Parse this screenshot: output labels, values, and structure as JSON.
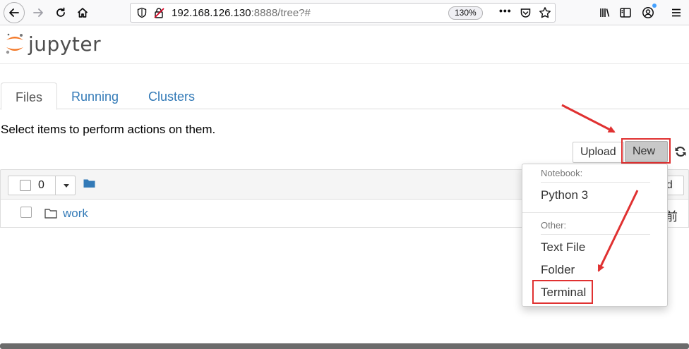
{
  "browser": {
    "url_host": "192.168.126.130",
    "url_rest": ":8888/tree?#",
    "zoom": "130%",
    "overflow_menu_label": "•••"
  },
  "app": {
    "logo_text": "jupyter",
    "brand_color": "#f37726"
  },
  "tabs": [
    {
      "label": "Files",
      "active": true
    },
    {
      "label": "Running",
      "active": false
    },
    {
      "label": "Clusters",
      "active": false
    }
  ],
  "instructions": "Select items to perform actions on them.",
  "actions": {
    "upload_label": "Upload",
    "new_label": "New"
  },
  "file_list": {
    "selected_count": "0",
    "right_button_fragment": "ed",
    "rows": [
      {
        "name": "work",
        "type": "folder",
        "modified_fragment": "前"
      }
    ]
  },
  "new_menu": {
    "notebook_header": "Notebook:",
    "notebook_items": [
      "Python 3"
    ],
    "other_header": "Other:",
    "other_items": [
      "Text File",
      "Folder",
      "Terminal"
    ]
  },
  "annotation_color": "#e03131"
}
